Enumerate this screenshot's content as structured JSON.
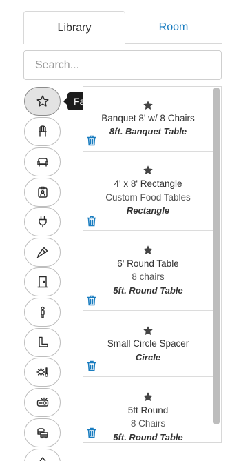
{
  "tabs": {
    "library": "Library",
    "room": "Room"
  },
  "search": {
    "placeholder": "Search..."
  },
  "tooltip": {
    "text": "Favorites"
  },
  "categories": [
    {
      "icon": "star-icon",
      "active": true
    },
    {
      "icon": "chair-icon"
    },
    {
      "icon": "sofa-icon"
    },
    {
      "icon": "id-badge-icon"
    },
    {
      "icon": "power-plug-icon"
    },
    {
      "icon": "microphone-icon"
    },
    {
      "icon": "door-icon"
    },
    {
      "icon": "person-icon"
    },
    {
      "icon": "stage-steps-icon"
    },
    {
      "icon": "gear-thermometer-icon"
    },
    {
      "icon": "projector-icon"
    },
    {
      "icon": "vehicles-icon"
    },
    {
      "icon": "lamp-icon"
    }
  ],
  "items": [
    {
      "name": "Banquet 8' w/ 8 Chairs",
      "sub": "",
      "type": "8ft. Banquet Table"
    },
    {
      "name": "4' x 8' Rectangle",
      "sub": "Custom Food Tables",
      "type": "Rectangle"
    },
    {
      "name": "6' Round Table",
      "sub": "8 chairs",
      "type": "5ft. Round Table"
    },
    {
      "name": "Small Circle Spacer",
      "sub": "",
      "type": "Circle"
    },
    {
      "name": "5ft Round",
      "sub": "8 Chairs",
      "type": "5ft. Round Table"
    }
  ],
  "colors": {
    "accent": "#1a7dc0",
    "tooltip_bg": "#1c1c1c",
    "active_category_bg": "#e3e3e3"
  }
}
